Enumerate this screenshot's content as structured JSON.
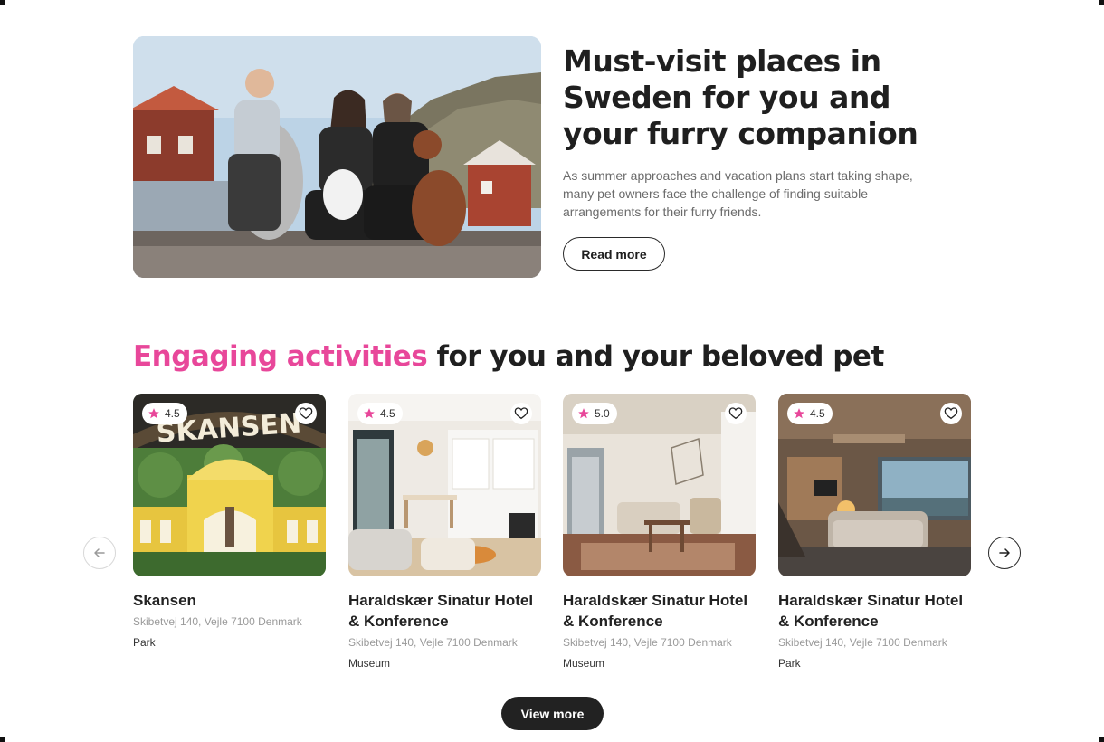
{
  "hero": {
    "title": "Must-visit places in Sweden for you and your furry companion",
    "description": "As summer approaches and vacation plans start taking shape, many pet owners face the challenge of finding suitable arrangements for their furry friends.",
    "read_more_label": "Read more"
  },
  "section": {
    "title_accent": "Engaging activities",
    "title_rest": " for you and your beloved pet"
  },
  "cards": [
    {
      "rating": "4.5",
      "title": "Skansen",
      "address": "Skibetvej 140, Vejle 7100 Denmark",
      "category": "Park",
      "image_text": "SKANSEN"
    },
    {
      "rating": "4.5",
      "title": "Haraldskær Sinatur Hotel & Konference",
      "address": "Skibetvej 140, Vejle 7100 Denmark",
      "category": "Museum"
    },
    {
      "rating": "5.0",
      "title": "Haraldskær Sinatur Hotel & Konference",
      "address": "Skibetvej 140, Vejle 7100 Denmark",
      "category": "Museum"
    },
    {
      "rating": "4.5",
      "title": "Haraldskær Sinatur Hotel & Konference",
      "address": "Skibetvej 140, Vejle 7100 Denmark",
      "category": "Park"
    }
  ],
  "view_more_label": "View more",
  "icons": {
    "rating": "star-icon",
    "favorite": "heart-icon",
    "prev": "arrow-left-icon",
    "next": "arrow-right-icon"
  },
  "colors": {
    "accent": "#e8479a",
    "text": "#1f1f1f",
    "muted": "#6b6b6b",
    "button_dark": "#222222"
  }
}
